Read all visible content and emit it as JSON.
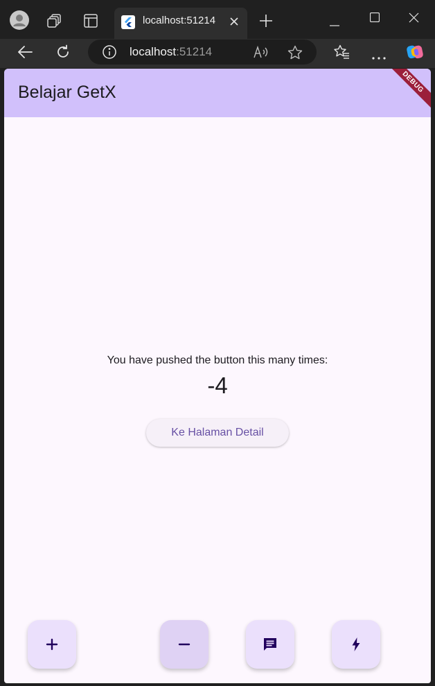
{
  "browser": {
    "tab": {
      "title": "localhost:51214"
    },
    "address": {
      "host": "localhost",
      "port": ":51214"
    }
  },
  "app": {
    "title": "Belajar GetX",
    "debug_banner": "DEBUG",
    "counter_label": "You have pushed the button this many times:",
    "counter_value": "-4",
    "detail_button_label": "Ke Halaman Detail",
    "fabs": [
      {
        "name": "increment",
        "icon": "plus-icon"
      },
      {
        "name": "decrement",
        "icon": "minus-icon"
      },
      {
        "name": "message",
        "icon": "message-icon"
      },
      {
        "name": "flash",
        "icon": "bolt-icon"
      }
    ]
  },
  "colors": {
    "appbar": "#d1c0fb",
    "background": "#fdf7fe",
    "fab": "#ebe0fc",
    "primary_text": "#6750a4",
    "debug_ribbon": "#9b1f3a"
  }
}
